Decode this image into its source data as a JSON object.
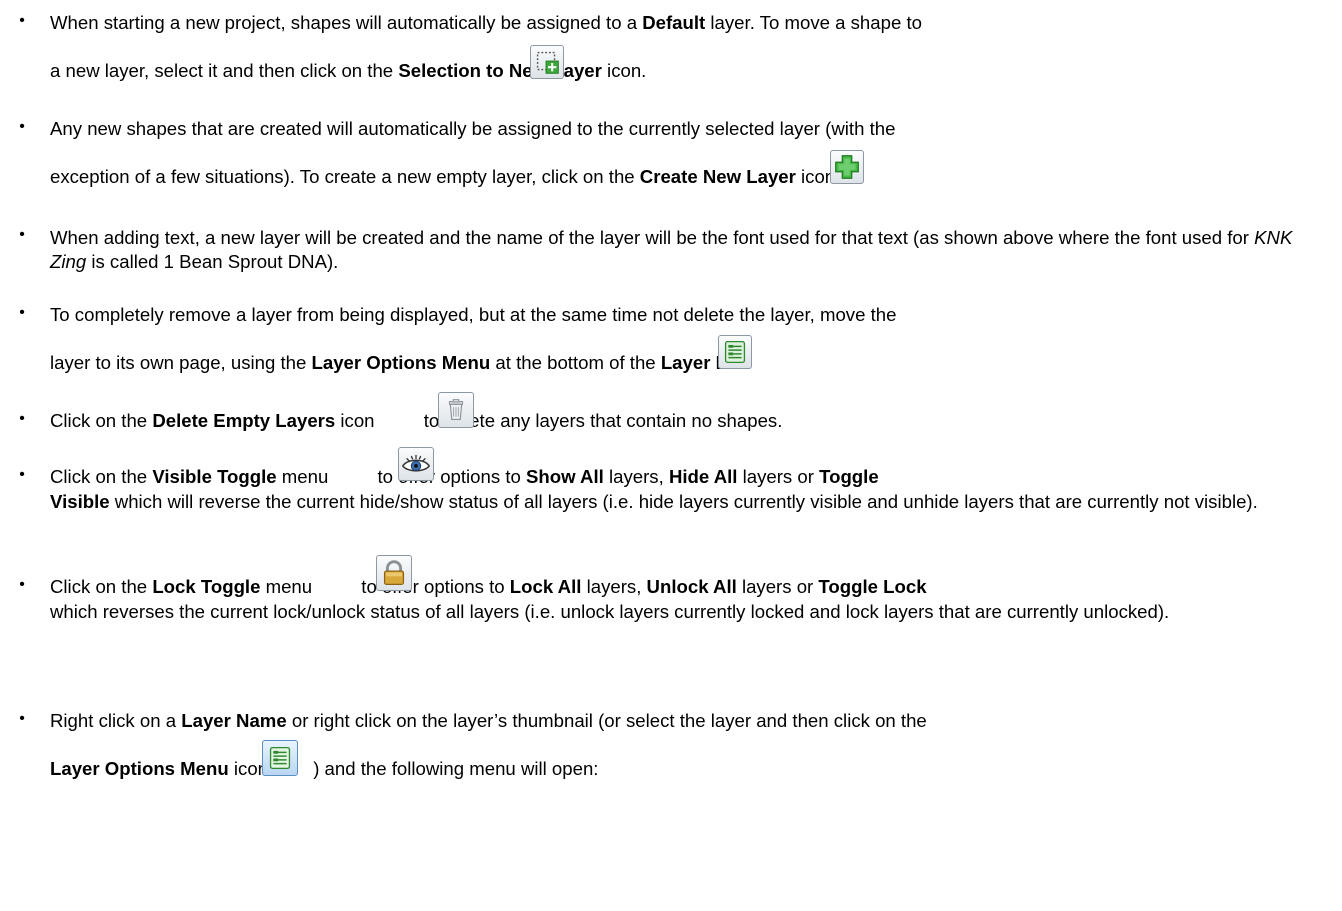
{
  "bullet_char": "•",
  "b1": {
    "l1_a": "When starting a new project, shapes will automatically be assigned to a ",
    "l1_b": "Default",
    "l1_c": " layer. To move a shape to",
    "l2_a": "a new layer, select it and then click on the ",
    "l2_b": "Selection to New Layer",
    "l2_c": " icon."
  },
  "b2": {
    "l1": "Any new shapes that are created will automatically be assigned to the currently selected layer (with the",
    "l2_a": "exception of a few situations).  To create a new empty layer, click on the ",
    "l2_b": "Create New Layer",
    "l2_c": " icon."
  },
  "b3": {
    "a": "When adding text, a new layer will be created and the name of the layer will be the font used for that text (as shown above where the font used for ",
    "b": "KNK Zing",
    "c": " is called 1 Bean Sprout DNA)."
  },
  "b4": {
    "l1": "To completely remove a layer from being displayed, but at the same time not delete the layer, move the",
    "l2_a": "layer to its own page, using the ",
    "l2_b": "Layer Options Menu",
    "l2_c": " at the bottom of the ",
    "l2_d": "Layer Bar."
  },
  "b5": {
    "a": "Click on the ",
    "b": "Delete Empty Layers",
    "c": " icon",
    "d": " to delete any layers that contain no shapes."
  },
  "b6": {
    "a": "Click on the ",
    "b": "Visible Toggle",
    "c": " menu",
    "d": " to offer options to ",
    "e": "Show All",
    "f": " layers, ",
    "g": "Hide All",
    "h": " layers or ",
    "i": "Toggle",
    "j": "Visible",
    "k": " which will reverse the current hide/show status of all layers (i.e. hide layers currently visible and unhide layers that are currently not visible)."
  },
  "b7": {
    "a": "Click on the ",
    "b": "Lock Toggle",
    "c": " menu",
    "d": " to offer options to ",
    "e": "Lock All",
    "f": " layers, ",
    "g": "Unlock All",
    "h": " layers or ",
    "i": "Toggle Lock",
    "j": " which reverses the current lock/unlock status of all layers (i.e. unlock layers currently locked and lock layers that are currently unlocked)."
  },
  "b8": {
    "l1_a": "Right click on a ",
    "l1_b": "Layer Name",
    "l1_c": " or right click on the layer’s thumbnail (or select the layer and then click on the",
    "l2_a": "Layer Options Menu",
    "l2_b": " icon ",
    "l2_c": ") and the following menu will open:"
  },
  "icons": {
    "selection_to_new_layer": "selection-to-new-layer-icon",
    "create_new_layer": "create-new-layer-icon",
    "layer_options_menu": "layer-options-menu-icon",
    "delete_empty_layers": "trash-icon",
    "visible_toggle": "eye-icon",
    "lock_toggle": "padlock-icon"
  }
}
